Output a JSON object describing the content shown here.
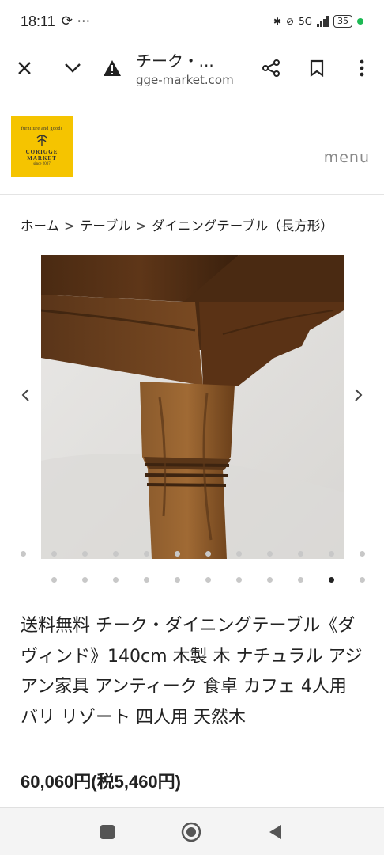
{
  "status_bar": {
    "time": "18:11",
    "extra_icons": "⟳ ⋯",
    "network": "5G",
    "battery": "35"
  },
  "browser": {
    "title": "チーク・...",
    "url": "gge-market.com",
    "close_icon": "close-icon",
    "dropdown_icon": "chevron-down-icon",
    "warning_icon": "warning-icon",
    "share_icon": "share-icon",
    "bookmark_icon": "bookmark-icon",
    "menu_icon": "more-vertical-icon"
  },
  "site": {
    "logo_small": "furniture and goods",
    "logo_name_1": "CORIGGE",
    "logo_name_2": "MARKET",
    "logo_since": "since 2007",
    "menu_label": "menu"
  },
  "breadcrumb": {
    "items": [
      "ホーム",
      "テーブル",
      "ダイニングテーブル（長方形）"
    ],
    "separator": ">"
  },
  "gallery": {
    "upper_dots_count": 13,
    "lower_dots_count": 11,
    "active_lower_dot": 9
  },
  "product": {
    "title": "送料無料 チーク・ダイニングテーブル《ダヴィンド》140cm 木製 木 ナチュラル アジアン家具 アンティーク 食卓 カフェ 4人用 バリ リゾート 四人用 天然木",
    "price": "60,060円(税5,460円)"
  },
  "colors": {
    "logo_bg": "#f5c400",
    "wood_dark": "#3d2410",
    "wood_mid": "#6b3f1c",
    "active_dot": "#222222"
  }
}
